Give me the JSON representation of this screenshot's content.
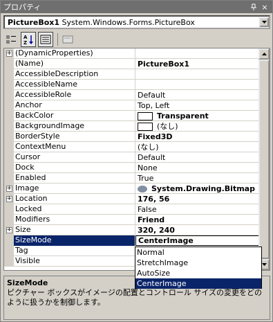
{
  "window": {
    "title": "プロパティ",
    "pin_glyph": "ᵖ",
    "close_glyph": "×"
  },
  "object_selector": {
    "name": "PictureBox1",
    "type": "System.Windows.Forms.PictureBox"
  },
  "toolbar": {
    "buttons": [
      {
        "icon": "categorized-icon",
        "pressed": false
      },
      {
        "icon": "alphabetical-icon",
        "pressed": true
      },
      {
        "icon": "properties-icon",
        "pressed": true
      },
      {
        "icon": "property-pages-icon",
        "pressed": false
      }
    ]
  },
  "properties": [
    {
      "name": "(DynamicProperties)",
      "value": "",
      "expander": true
    },
    {
      "name": "(Name)",
      "value": "PictureBox1",
      "bold": true
    },
    {
      "name": "AccessibleDescription",
      "value": ""
    },
    {
      "name": "AccessibleName",
      "value": ""
    },
    {
      "name": "AccessibleRole",
      "value": "Default"
    },
    {
      "name": "Anchor",
      "value": "Top, Left"
    },
    {
      "name": "BackColor",
      "value": "Transparent",
      "bold": true,
      "swatch": "#ffffff"
    },
    {
      "name": "BackgroundImage",
      "value": "(なし)",
      "swatch": "#ffffff"
    },
    {
      "name": "BorderStyle",
      "value": "Fixed3D",
      "bold": true
    },
    {
      "name": "ContextMenu",
      "value": "(なし)"
    },
    {
      "name": "Cursor",
      "value": "Default"
    },
    {
      "name": "Dock",
      "value": "None"
    },
    {
      "name": "Enabled",
      "value": "True"
    },
    {
      "name": "Image",
      "value": "System.Drawing.Bitmap",
      "bold": true,
      "expander": true,
      "bitmap": true
    },
    {
      "name": "Location",
      "value": "176, 56",
      "bold": true,
      "expander": true
    },
    {
      "name": "Locked",
      "value": "False"
    },
    {
      "name": "Modifiers",
      "value": "Friend",
      "bold": true
    },
    {
      "name": "Size",
      "value": "320, 240",
      "bold": true,
      "expander": true
    },
    {
      "name": "SizeMode",
      "value": "CenterImage",
      "bold": true,
      "selected": true
    },
    {
      "name": "Tag",
      "value": ""
    },
    {
      "name": "Visible",
      "value": ""
    }
  ],
  "sizemode_options": [
    "Normal",
    "StretchImage",
    "AutoSize",
    "CenterImage"
  ],
  "sizemode_selected": "CenterImage",
  "description": {
    "title": "SizeMode",
    "text": "ピクチャー ボックスがイメージの配置とコントロール サイズの変更をどのように扱うかを制御します。"
  },
  "colors": {
    "selection": "#0a246a",
    "titlebar": "#6f6f6f",
    "face": "#d4d0c8"
  }
}
